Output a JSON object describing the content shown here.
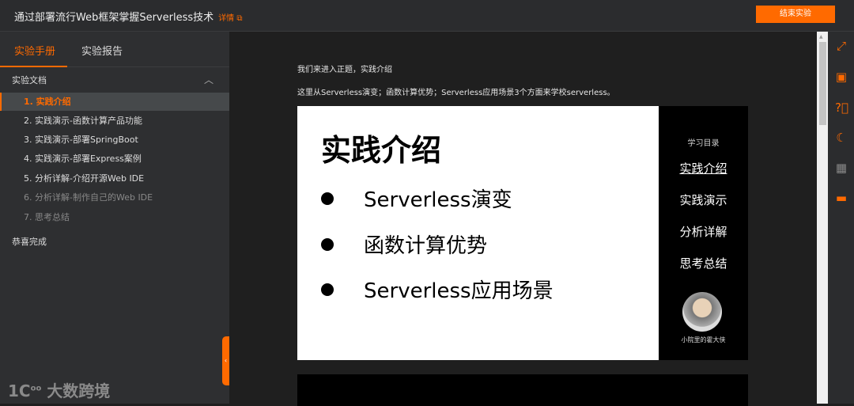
{
  "header": {
    "title": "通过部署流行Web框架掌握Serverless技术",
    "detail_link": "详情",
    "end_button": "结束实验"
  },
  "sidebar": {
    "tabs": [
      "实验手册",
      "实验报告"
    ],
    "section": "实验文档",
    "items": [
      {
        "label": "1. 实践介绍",
        "state": "active"
      },
      {
        "label": "2. 实践演示-函数计算产品功能",
        "state": "normal"
      },
      {
        "label": "3. 实践演示-部署SpringBoot",
        "state": "normal"
      },
      {
        "label": "4. 实践演示-部署Express案例",
        "state": "normal"
      },
      {
        "label": "5. 分析详解-介绍开源Web IDE",
        "state": "normal"
      },
      {
        "label": "6. 分析详解-制作自己的Web IDE",
        "state": "dim"
      },
      {
        "label": "7. 思考总结",
        "state": "dim"
      }
    ],
    "done": "恭喜完成",
    "watermark": "大数跨境"
  },
  "content": {
    "p1": "我们来进入正题，实践介绍",
    "p2": "这里从Serverless演变；函数计算优势；Serverless应用场景3个方面来学校serverless。",
    "slide": {
      "title": "实践介绍",
      "bullets": [
        "Serverless演变",
        "函数计算优势",
        "Serverless应用场景"
      ],
      "toc_heading": "学习目录",
      "toc": [
        "实践介绍",
        "实践演示",
        "分析详解",
        "思考总结"
      ],
      "author": "小院里的霍大侠"
    }
  },
  "rail": {
    "icons": [
      "fullscreen-icon",
      "calendar-icon",
      "help-icon",
      "moon-icon",
      "qrcode-icon",
      "chat-icon"
    ]
  },
  "colors": {
    "accent": "#ff6a00"
  }
}
